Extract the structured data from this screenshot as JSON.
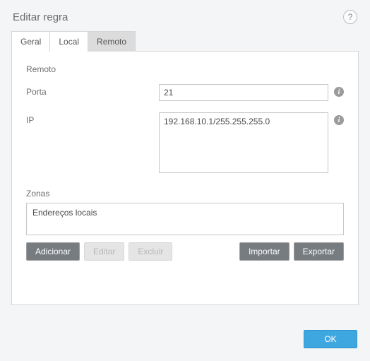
{
  "header": {
    "title": "Editar regra",
    "help_glyph": "?"
  },
  "tabs": {
    "geral": "Geral",
    "local": "Local",
    "remoto": "Remoto",
    "active": "remoto"
  },
  "panel": {
    "section_heading": "Remoto",
    "port": {
      "label": "Porta",
      "value": "21"
    },
    "ip": {
      "label": "IP",
      "value": "192.168.10.1/255.255.255.0"
    },
    "zones": {
      "label": "Zonas",
      "items": [
        "Endereços locais"
      ]
    },
    "buttons": {
      "add": "Adicionar",
      "edit": "Editar",
      "delete": "Excluir",
      "import": "Importar",
      "export": "Exportar"
    }
  },
  "footer": {
    "ok": "OK"
  },
  "icons": {
    "info_glyph": "i"
  }
}
